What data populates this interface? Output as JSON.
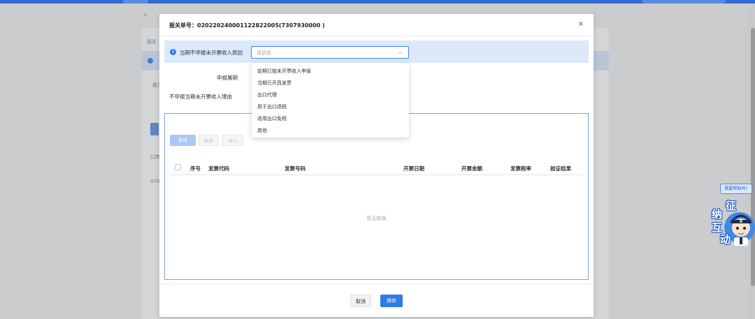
{
  "background": {
    "back_arrow": "←",
    "tab_label": "报关",
    "label_1": "报关",
    "label_2": "口岸",
    "label_3": "079"
  },
  "help": {
    "bubble_text": "需要帮助吗?",
    "mascot_chars": [
      "征",
      "纳",
      "互",
      "动"
    ]
  },
  "modal": {
    "title": "报关单号：020220240001122822005(7307930000 )",
    "close_icon": "×",
    "reason_label": "当期不申报未开票收入原因",
    "reason_placeholder": "请选择",
    "period_label": "申报属期",
    "no_declare_reason_label": "不申报当期未开票收入理由",
    "reason_options": [
      "前期已按未开票收入申报",
      "当期已开具发票",
      "出口代理",
      "用于出口退税",
      "适用出口免税",
      "其他"
    ],
    "toolbar": {
      "new_label": "新增",
      "delete_label": "删除",
      "import_label": "导入"
    },
    "table": {
      "headers": [
        "序号",
        "发票代码",
        "发票号码",
        "开票日期",
        "开票金额",
        "发票税率",
        "验证结果"
      ],
      "empty_text": "暂无数据"
    },
    "footer": {
      "cancel_label": "取消",
      "save_label": "保存"
    }
  },
  "colors": {
    "primary": "#2f7be5",
    "info_bg": "#dbe9fb",
    "overlay": "#c8c9cb"
  }
}
